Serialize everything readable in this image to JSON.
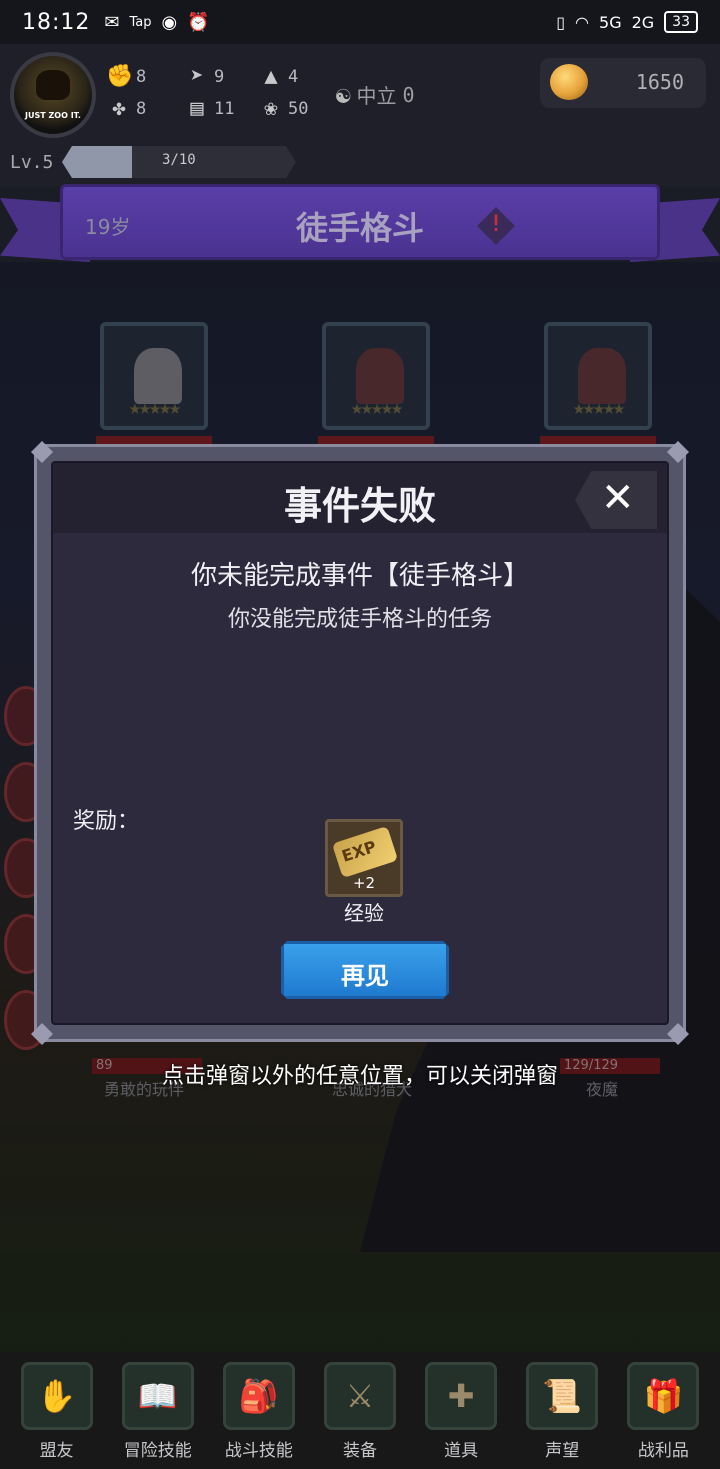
{
  "status_bar": {
    "time": "18:12",
    "app_icons": [
      "wechat-icon",
      "tap-icon",
      "eye-icon",
      "alarm-icon"
    ],
    "signal_5g": "5G",
    "signal_2g": "2G",
    "battery": "33"
  },
  "hud": {
    "avatar_logo": "JUST ZOO IT.",
    "stats": {
      "fist": "8",
      "clover": "8",
      "speed": "9",
      "armor": "11",
      "magic": "4",
      "wisdom": "50"
    },
    "alignment_label": "中立",
    "alignment_value": "0",
    "gold": "1650",
    "level": "Lv.5",
    "xp_text": "3/10",
    "xp_fraction": 0.3
  },
  "banner": {
    "age": "19岁",
    "event_title": "徒手格斗",
    "warn_glyph": "!"
  },
  "scene": {
    "hint": "点击弹窗以外的任意位置，可以关闭弹窗",
    "labels": [
      "勇敢的玩伴",
      "忠诚的猎犬",
      "夜魔"
    ],
    "hp_left": "89",
    "hp_right": "129/129"
  },
  "modal": {
    "title": "事件失败",
    "close_glyph": "✕",
    "message": "你未能完成事件【徒手格斗】",
    "detail": "你没能完成徒手格斗的任务",
    "reward_label": "奖励：",
    "reward": {
      "icon_text": "EXP",
      "qty": "+2",
      "name": "经验"
    },
    "button": "再见"
  },
  "nav": [
    {
      "label": "盟友",
      "icon": "handshake-icon",
      "glyph": "✋"
    },
    {
      "label": "冒险技能",
      "icon": "book-icon",
      "glyph": "📖"
    },
    {
      "label": "战斗技能",
      "icon": "backpack-icon",
      "glyph": "🎒"
    },
    {
      "label": "装备",
      "icon": "swords-icon",
      "glyph": "⚔"
    },
    {
      "label": "道具",
      "icon": "pouch-icon",
      "glyph": "✚"
    },
    {
      "label": "声望",
      "icon": "scroll-icon",
      "glyph": "📜"
    },
    {
      "label": "战利品",
      "icon": "chest-icon",
      "glyph": "🎁"
    }
  ]
}
